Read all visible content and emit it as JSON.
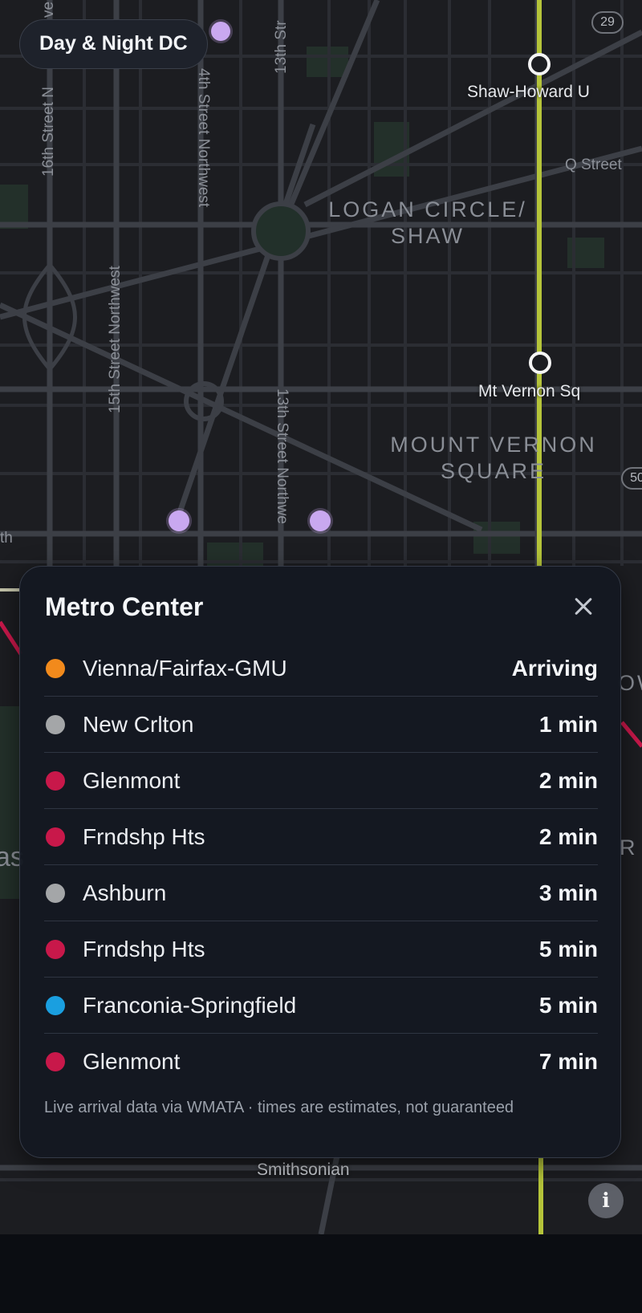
{
  "app": {
    "title": "Day & Night DC"
  },
  "map": {
    "street_labels": {
      "s16th": "16th Street N",
      "s14th": "4th Street Northwest",
      "s13th_top": "13th Str",
      "s15th": "15th Street Northwest",
      "s13th_mid": "13th Street Northwe",
      "q_street": "Q Street",
      "th_fragment": "th",
      "ve_fragment": "ve",
      "as_fragment": "as",
      "ow_fragment": "OW",
      "r_fragment": "R"
    },
    "districts": {
      "logan_line1": "LOGAN CIRCLE/",
      "logan_line2": "SHAW",
      "mvsq_line1": "MOUNT VERNON",
      "mvsq_line2": "SQUARE"
    },
    "stations": {
      "shaw": "Shaw-Howard U",
      "mt_vernon": "Mt Vernon Sq",
      "smithsonian": "Smithsonian"
    },
    "route_shields": {
      "r29": "29",
      "r50": "50"
    },
    "icons": {
      "info": "info-icon",
      "close": "close-icon"
    },
    "colors": {
      "yellow_line": "#b5c43a",
      "poi": "#c9a8f0",
      "background": "#1c1d21"
    }
  },
  "panel": {
    "title": "Metro Center",
    "arrivals": [
      {
        "destination": "Vienna/Fairfax-GMU",
        "eta": "Arriving",
        "line_color": "#f28a1c"
      },
      {
        "destination": "New Crlton",
        "eta": "1 min",
        "line_color": "#a4a6a8"
      },
      {
        "destination": "Glenmont",
        "eta": "2 min",
        "line_color": "#c8184a"
      },
      {
        "destination": "Frndshp Hts",
        "eta": "2 min",
        "line_color": "#c8184a"
      },
      {
        "destination": "Ashburn",
        "eta": "3 min",
        "line_color": "#a4a6a8"
      },
      {
        "destination": "Frndshp Hts",
        "eta": "5 min",
        "line_color": "#c8184a"
      },
      {
        "destination": "Franconia-Springfield",
        "eta": "5 min",
        "line_color": "#1a9fe0"
      },
      {
        "destination": "Glenmont",
        "eta": "7 min",
        "line_color": "#c8184a"
      }
    ],
    "footnote": "Live arrival data via WMATA · times are estimates, not guaranteed"
  }
}
